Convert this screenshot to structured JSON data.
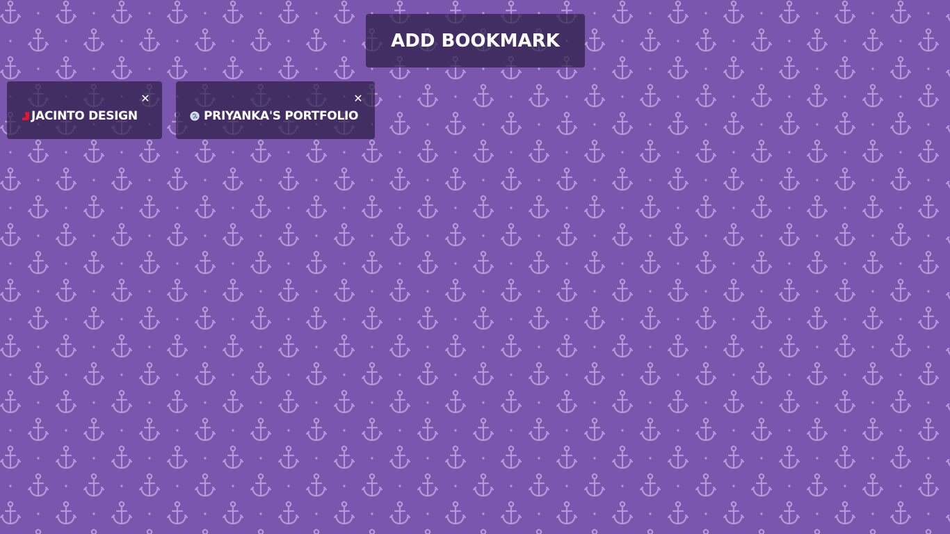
{
  "page": {
    "background_color": "#7b56ae",
    "pattern_icon": "anchor-icon",
    "pattern_color": "#b49bd6"
  },
  "toolbar": {
    "add_label": "ADD BOOKMARK"
  },
  "bookmarks": [
    {
      "label": "JACINTO DESIGN",
      "favicon": "jacinto-favicon-icon",
      "favicon_color": "#e0182d",
      "close_icon": "close-icon"
    },
    {
      "label": "PRIYANKA'S PORTFOLIO",
      "favicon": "globe-icon",
      "close_icon": "close-icon"
    }
  ]
}
